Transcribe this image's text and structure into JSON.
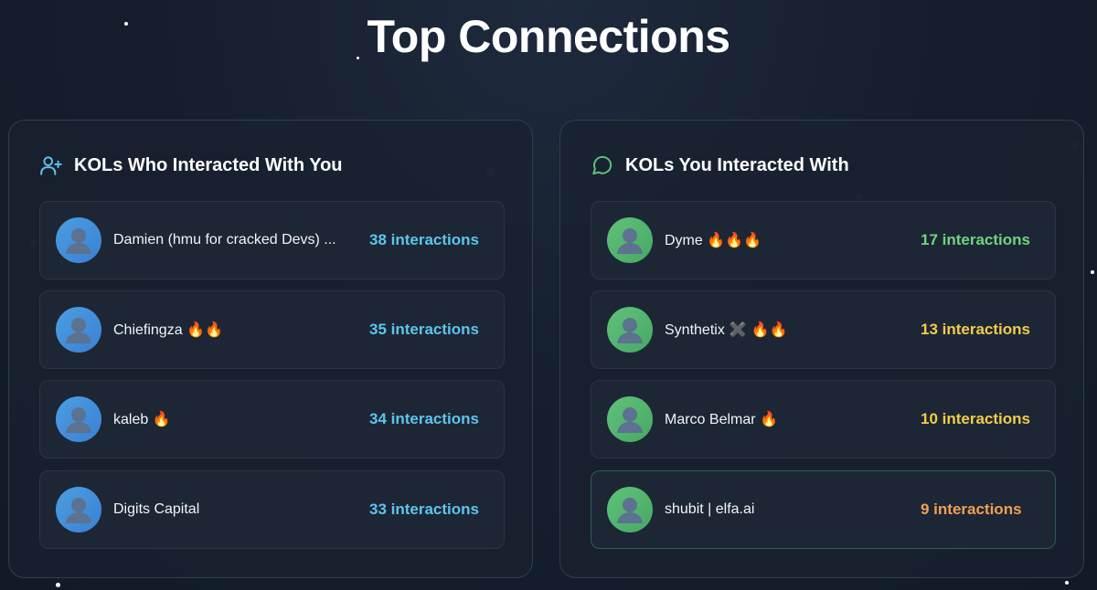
{
  "page": {
    "title": "Top Connections"
  },
  "left_panel": {
    "title": "KOLs Who Interacted With You",
    "icon": "user-plus-icon",
    "accent": "#5ec4ec",
    "items": [
      {
        "name": "Damien (hmu for cracked Devs) ...",
        "count": "38 interactions",
        "count_color": "#5ec4ec"
      },
      {
        "name": "Chiefingza 🔥🔥",
        "count": "35 interactions",
        "count_color": "#5ec4ec"
      },
      {
        "name": "kaleb 🔥",
        "count": "34 interactions",
        "count_color": "#5ec4ec"
      },
      {
        "name": "Digits Capital",
        "count": "33 interactions",
        "count_color": "#5ec4ec"
      }
    ]
  },
  "right_panel": {
    "title": "KOLs You Interacted With",
    "icon": "chat-bubble-icon",
    "accent": "#5fc27a",
    "items": [
      {
        "name": "Dyme 🔥🔥🔥",
        "count": "17 interactions",
        "count_color": "#6fd57f"
      },
      {
        "name": "Synthetix ✖️ 🔥🔥",
        "count": "13 interactions",
        "count_color": "#f2cc4b"
      },
      {
        "name": "Marco Belmar 🔥",
        "count": "10 interactions",
        "count_color": "#f2cc4b"
      },
      {
        "name": "shubit | elfa.ai",
        "count": "9 interactions",
        "count_color": "#f0a054"
      }
    ]
  }
}
